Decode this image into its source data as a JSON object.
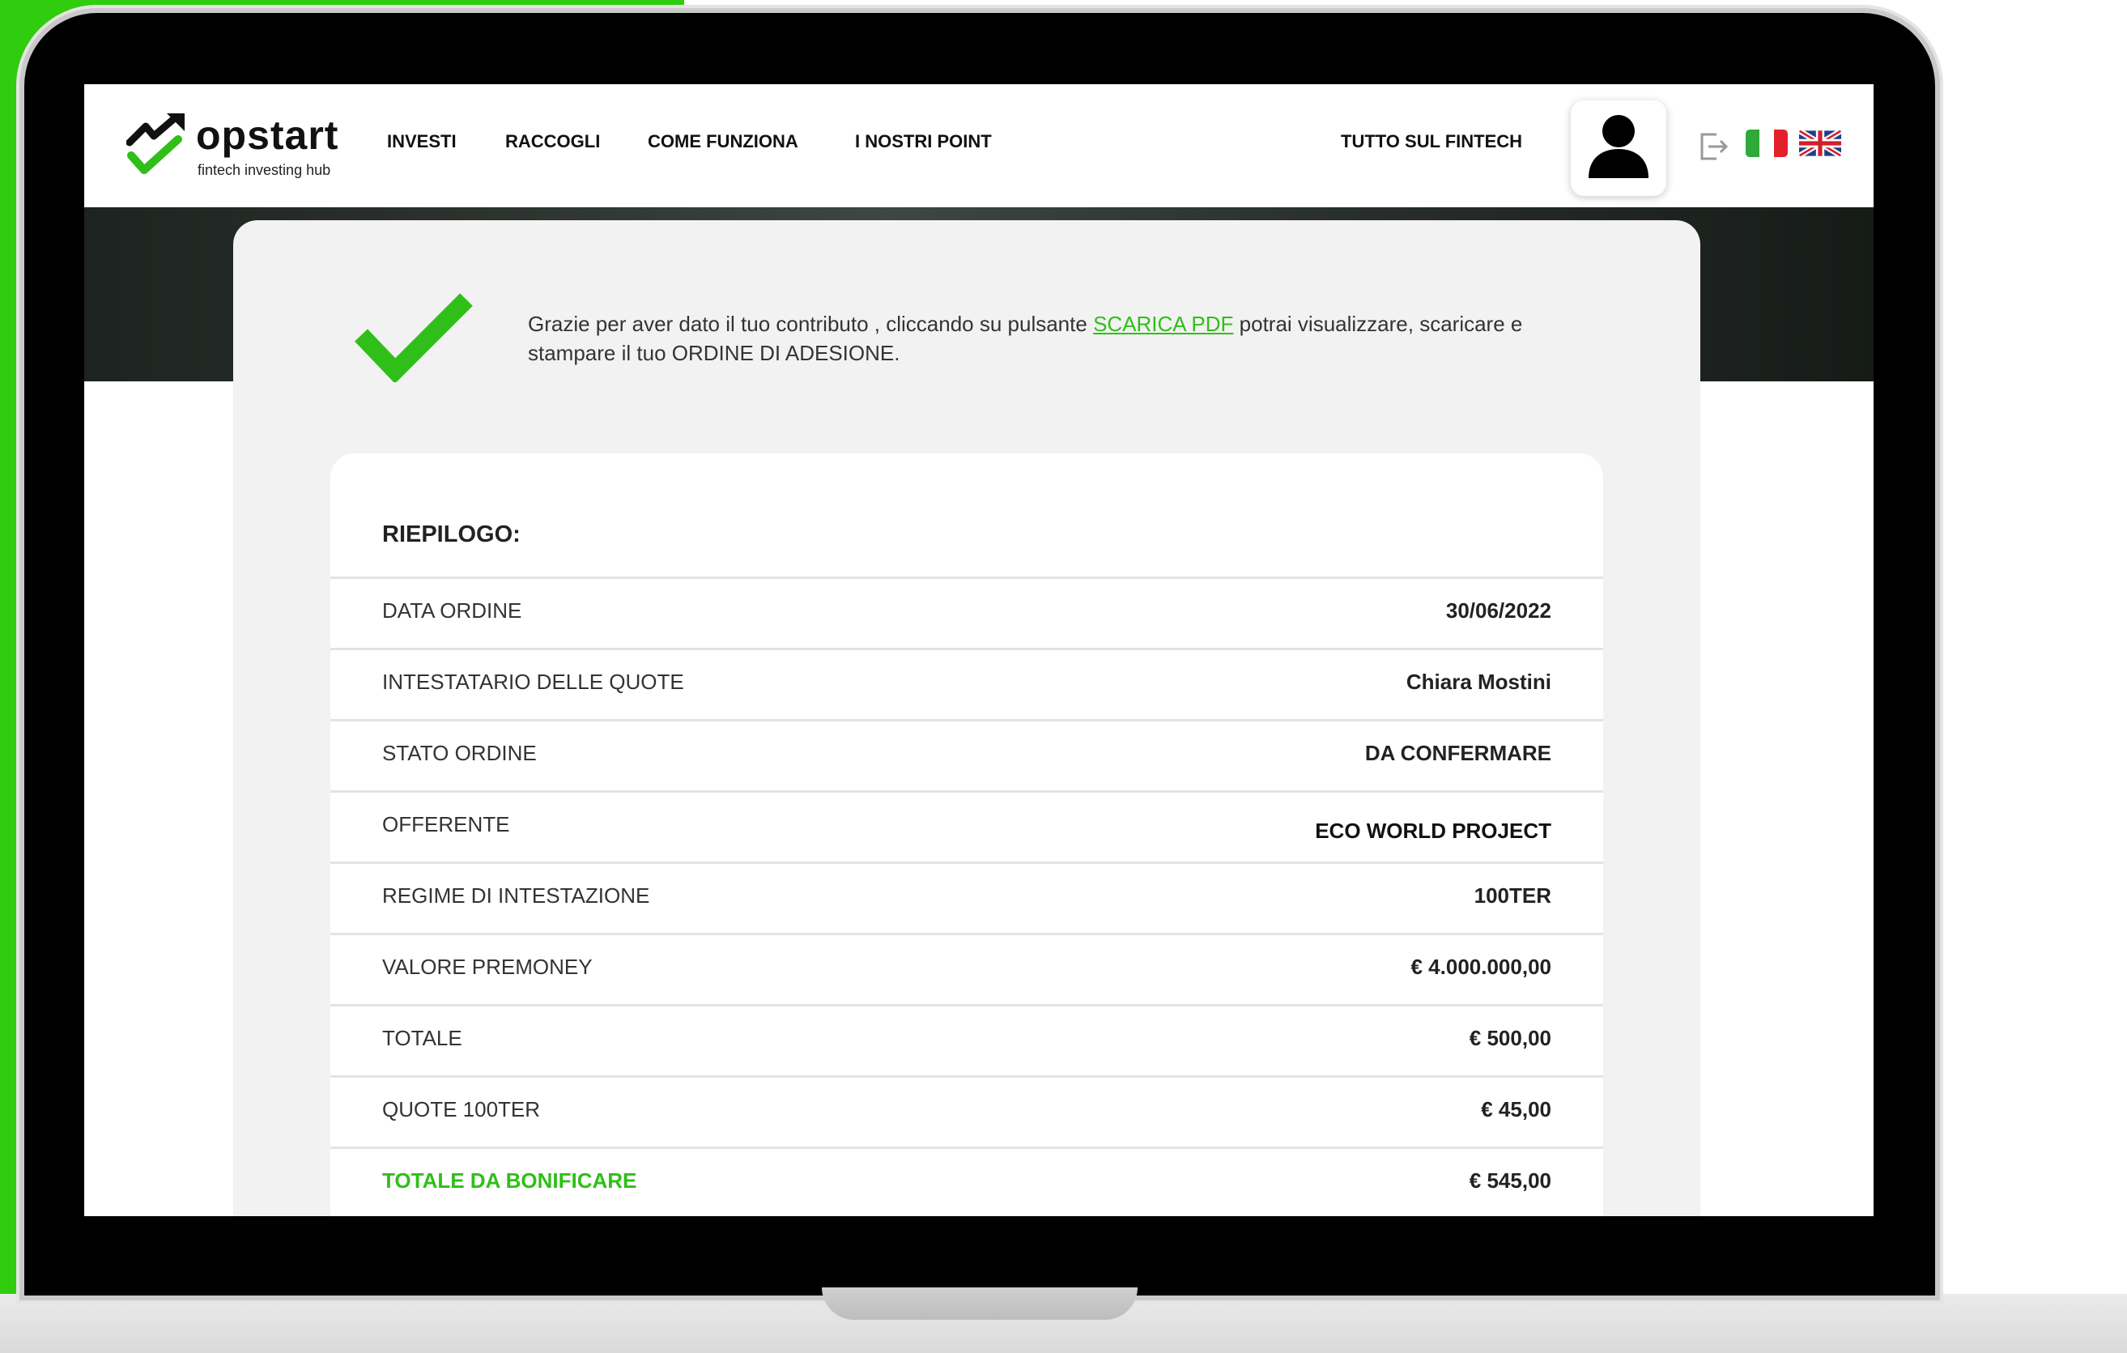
{
  "brand": {
    "name": "opstart",
    "tagline": "fintech investing hub",
    "accent_color": "#2fbf18"
  },
  "nav": {
    "items": [
      "INVESTI",
      "RACCOGLI",
      "COME FUNZIONA",
      "I NOSTRI POINT"
    ],
    "right_link": "TUTTO SUL FINTECH"
  },
  "icons": {
    "user": "user-icon",
    "logout": "logout-icon",
    "language_it": "flag-italy-icon",
    "language_en": "flag-uk-icon",
    "success": "checkmark-icon"
  },
  "confirmation": {
    "text_before": "Grazie per aver dato il tuo contributo , cliccando su pulsante ",
    "link_label": "SCARICA PDF",
    "text_after": " potrai visualizzare, scaricare e stampare il tuo ORDINE DI ADESIONE."
  },
  "summary": {
    "title": "RIEPILOGO:",
    "rows": [
      {
        "label": "DATA ORDINE",
        "value": "30/06/2022"
      },
      {
        "label": "INTESTATARIO DELLE QUOTE",
        "value": "Chiara Mostini"
      },
      {
        "label": "STATO ORDINE",
        "value": "DA CONFERMARE"
      },
      {
        "label": "OFFERENTE",
        "value": "ECO WORLD PROJECT"
      },
      {
        "label": "REGIME DI INTESTAZIONE",
        "value": "100TER"
      },
      {
        "label": "VALORE PREMONEY",
        "value": "€ 4.000.000,00"
      },
      {
        "label": "TOTALE",
        "value": "€ 500,00"
      },
      {
        "label": "QUOTE 100TER",
        "value": "€ 45,00"
      },
      {
        "label": "TOTALE DA BONIFICARE",
        "value": "€ 545,00"
      }
    ]
  }
}
